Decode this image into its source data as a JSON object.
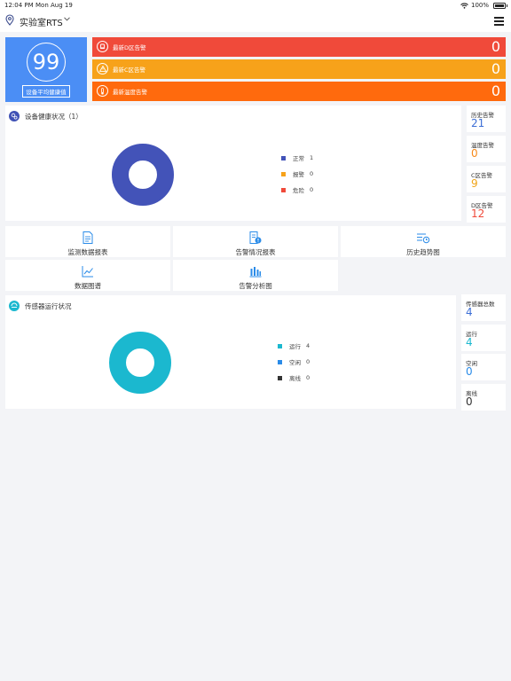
{
  "statusbar": {
    "time": "12:04 PM",
    "date": "Mon Aug 19",
    "battery": "100%"
  },
  "navbar": {
    "title": "实验室RTS"
  },
  "health": {
    "score": "99",
    "label": "设备平均健康值"
  },
  "alarms": [
    {
      "label": "最新D区告警",
      "count": "0",
      "color": "#f04a3a",
      "icon": "bell-icon"
    },
    {
      "label": "最新C区告警",
      "count": "0",
      "color": "#f7a21a",
      "icon": "warning-icon"
    },
    {
      "label": "最新温度告警",
      "count": "0",
      "color": "#ff6a0d",
      "icon": "thermometer-icon"
    }
  ],
  "device_status": {
    "title": "设备健康状况（1）",
    "legend": [
      {
        "label": "正常",
        "value": "1",
        "color": "#4353b8"
      },
      {
        "label": "报警",
        "value": "0",
        "color": "#f7a21a"
      },
      {
        "label": "危险",
        "value": "0",
        "color": "#f04a3a"
      }
    ]
  },
  "history_stats": [
    {
      "label": "历史告警",
      "value": "21",
      "color": "#3d6fd6"
    },
    {
      "label": "温度告警",
      "value": "0",
      "color": "#f78a1a"
    },
    {
      "label": "C区告警",
      "value": "9",
      "color": "#f0a51a"
    },
    {
      "label": "D区告警",
      "value": "12",
      "color": "#f04a3a"
    }
  ],
  "functions": [
    {
      "label": "监测数据报表",
      "icon": "document-icon"
    },
    {
      "label": "告警情况报表",
      "icon": "alert-report-icon"
    },
    {
      "label": "历史趋势图",
      "icon": "trend-list-icon"
    },
    {
      "label": "数据图谱",
      "icon": "line-chart-icon"
    },
    {
      "label": "告警分析图",
      "icon": "bar-chart-icon"
    }
  ],
  "sensor_status": {
    "title": "传感器运行状况",
    "legend": [
      {
        "label": "运行",
        "value": "4",
        "color": "#1bb8cf"
      },
      {
        "label": "空闲",
        "value": "0",
        "color": "#2a8be8"
      },
      {
        "label": "离线",
        "value": "0",
        "color": "#333333"
      }
    ]
  },
  "sensor_stats": [
    {
      "label": "传感器总数",
      "value": "4",
      "color": "#3d6fd6"
    },
    {
      "label": "运行",
      "value": "4",
      "color": "#1bb8cf"
    },
    {
      "label": "空闲",
      "value": "0",
      "color": "#2a8be8"
    },
    {
      "label": "离线",
      "value": "0",
      "color": "#333333"
    }
  ]
}
